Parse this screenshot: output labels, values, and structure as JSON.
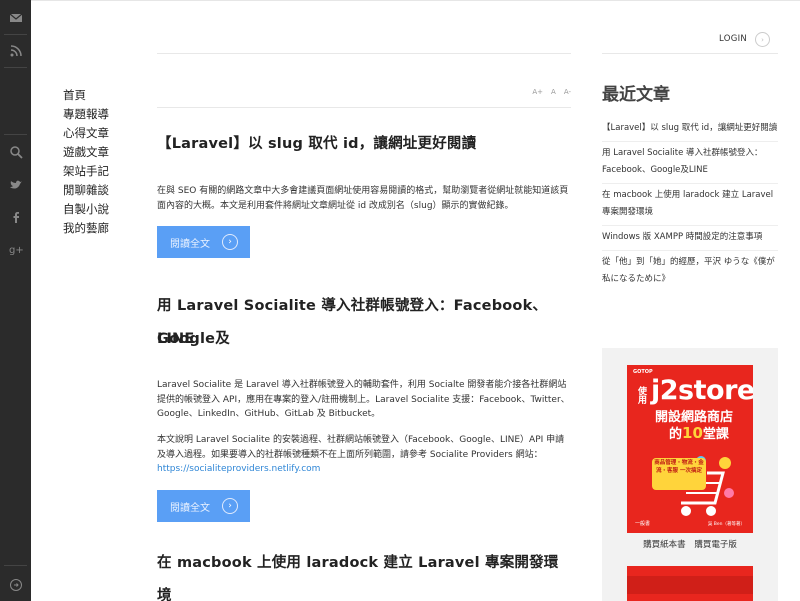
{
  "sidebar": {
    "icons": [
      "mail-icon",
      "rss-icon",
      "search-icon",
      "twitter-icon",
      "facebook-icon",
      "google-plus-icon",
      "arrow-circle-icon"
    ]
  },
  "header": {
    "login_label": "LOGIN"
  },
  "leftnav": {
    "items": [
      "首頁",
      "專題報導",
      "心得文章",
      "遊戲文章",
      "架站手記",
      "閒聊雜談",
      "自製小說",
      "我的藝廊"
    ]
  },
  "toolbar": {
    "font_sizes": [
      "A+",
      "A",
      "A-"
    ]
  },
  "posts": [
    {
      "title": "【Laravel】以 slug 取代 id，讓網址更好閱讀",
      "paragraphs": [
        "在與 SEO 有關的網路文章中大多會建議頁面網址使用容易閱讀的格式，幫助瀏覽者從網址就能知道該頁面內容的大概。本文是利用套件將網址文章網址從 id 改成別名（slug）顯示的實做紀錄。"
      ],
      "readmore": "閱讀全文"
    },
    {
      "title_line1": "用 Laravel Socialite 導入社群帳號登入：Facebook、Google及",
      "title_line2": "LINE",
      "paragraph1": "Laravel Socialite 是 Laravel 導入社群帳號登入的輔助套件，利用 Socialte 開發者能介接各社群網站提供的帳號登入 API，應用在專案的登入/註冊機制上。Laravel Socialite 支援：Facebook、Twitter、Google、LinkedIn、GitHub、GitLab 及 Bitbucket。",
      "paragraph2": "本文說明 Laravel Socialite 的安裝過程、社群網站帳號登入（Facebook、Google、LINE）API 申請及導入過程。如果要導入的社群帳號種類不在上面所列範圍，請參考 Socialite Providers 網站：",
      "link": "https://socialiteproviders.netlify.com",
      "readmore": "閱讀全文"
    },
    {
      "title": "在 macbook 上使用 laradock 建立 Laravel 專案開發環境"
    }
  ],
  "recent": {
    "heading": "最近文章",
    "items": [
      "【Laravel】以 slug 取代 id，讓網址更好閱讀",
      "用 Laravel Socialite 導入社群帳號登入：Facebook、Google及LINE",
      "在 macbook 上使用 laradock 建立 Laravel 專案開發環境",
      "Windows 版 XAMPP 時間設定的注意事項",
      "從「他」到「她」的經歷，平沢 ゆうな《僕が私になるために》"
    ]
  },
  "book": {
    "publisher": "GOTOP",
    "use": "使用",
    "title_main": "j2store",
    "title_sub1": "開設網路商店",
    "title_sub2_pre": "的",
    "title_sub2_num": "10",
    "title_sub2_post": "堂課",
    "tag": "商品管理・物流・金流・客服 一次搞定",
    "author": "一般書",
    "author2": "吳 Ben（著等著）",
    "link_print": "購買紙本書",
    "link_ebook": "購買電子版",
    "colors": {
      "cover": "#e8261e",
      "accent": "#ffd43b"
    }
  },
  "colors": {
    "readmore_button": "#5a9ff5",
    "sidebar_bg": "#2b2b2b",
    "link": "#2f86d6"
  }
}
